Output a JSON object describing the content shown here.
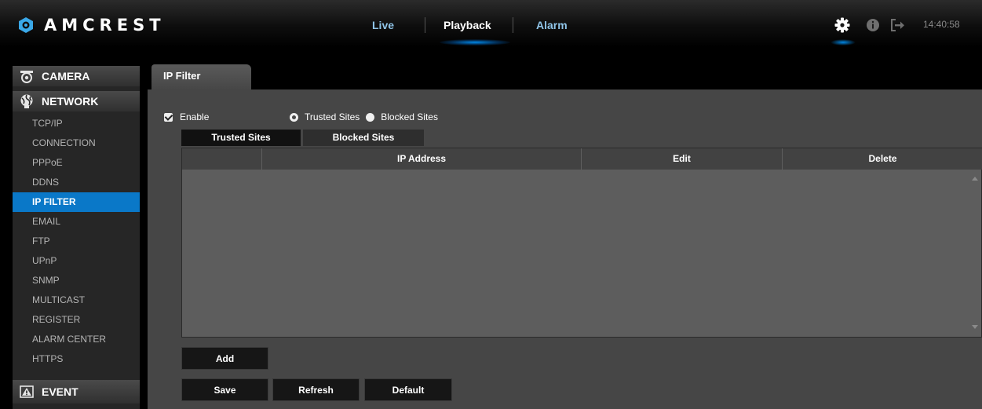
{
  "brand": {
    "name": "AMCREST"
  },
  "top_nav": {
    "tabs": [
      {
        "label": "Live",
        "active": false
      },
      {
        "label": "Playback",
        "active": true
      },
      {
        "label": "Alarm",
        "active": false
      }
    ]
  },
  "header_right": {
    "icons": [
      "gear-icon",
      "info-icon",
      "logout-icon"
    ],
    "clock": "14:40:58"
  },
  "sidebar": {
    "sections": {
      "camera": "CAMERA",
      "network": "NETWORK",
      "event": "EVENT"
    },
    "network_items": [
      {
        "label": "TCP/IP"
      },
      {
        "label": "CONNECTION"
      },
      {
        "label": "PPPoE"
      },
      {
        "label": "DDNS"
      },
      {
        "label": "IP FILTER",
        "active": true
      },
      {
        "label": "EMAIL"
      },
      {
        "label": "FTP"
      },
      {
        "label": "UPnP"
      },
      {
        "label": "SNMP"
      },
      {
        "label": "MULTICAST"
      },
      {
        "label": "REGISTER"
      },
      {
        "label": "ALARM CENTER"
      },
      {
        "label": "HTTPS"
      }
    ]
  },
  "page": {
    "tab_title": "IP Filter",
    "enable": {
      "label": "Enable",
      "checked": true
    },
    "mode": {
      "options": [
        {
          "label": "Trusted Sites",
          "selected": true
        },
        {
          "label": "Blocked Sites",
          "selected": false
        }
      ]
    },
    "sub_tabs": [
      {
        "label": "Trusted Sites",
        "active": true
      },
      {
        "label": "Blocked Sites",
        "active": false
      }
    ],
    "table": {
      "columns": [
        "",
        "IP Address",
        "Edit",
        "Delete"
      ],
      "rows": []
    },
    "buttons": {
      "add": "Add",
      "save": "Save",
      "refresh": "Refresh",
      "default": "Default"
    }
  },
  "colors": {
    "accent": "#0a78c8",
    "nav_inactive": "#8fc4e8",
    "panel_bg": "#464646"
  }
}
